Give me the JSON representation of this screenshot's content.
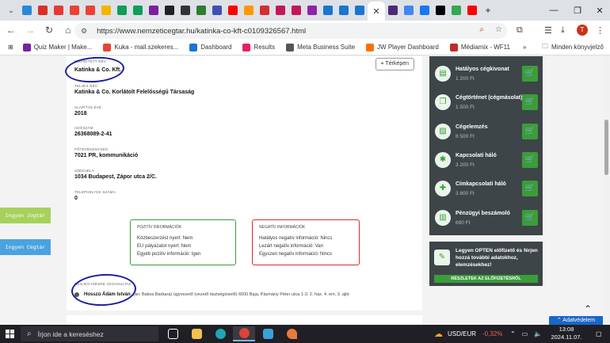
{
  "browser": {
    "url": "https://www.nemzeticegtar.hu/katinka-co-kft-c0109326567.html",
    "tab_favicon_colors": [
      "#2b88d8",
      "#d93025",
      "#e53935",
      "#ea4335",
      "#ea4335",
      "#f4b400",
      "#0f9d58",
      "#0f9d58",
      "#7b1fa2",
      "#212121",
      "#333333",
      "#2e7d32",
      "#3f51b5",
      "#ff0000",
      "#ff9800",
      "#d32f2f",
      "#c2185b",
      "#c2185b",
      "#8e24aa",
      "#1976d2",
      "#1976d2",
      "#1976d2"
    ],
    "right_tab_colors": [
      "#4b2a7a",
      "#4285f4",
      "#1877f2",
      "#000000",
      "#34a853",
      "#ff0000"
    ],
    "new_tab_icon": "plus-icon",
    "window_controls": [
      "minimize-icon",
      "maximize-icon",
      "close-icon"
    ]
  },
  "bookmarks": [
    {
      "label": "Quiz Maker | Make...",
      "color": "#7b1fa2"
    },
    {
      "label": "Kuka - mail.szekeres...",
      "color": "#ea4335"
    },
    {
      "label": "Dashboard",
      "color": "#1976d2"
    },
    {
      "label": "Results",
      "color": "#e91e63"
    },
    {
      "label": "Meta Business Suite",
      "color": "#555555"
    },
    {
      "label": "JW Player Dashboard",
      "color": "#ff6f00"
    },
    {
      "label": "Médiamix - WF11",
      "color": "#c62828"
    }
  ],
  "bookmarks_other": "Minden könyvjelző",
  "company": {
    "short_name_label": "Rövidített név",
    "short_name": "Katinka & Co. Kft.",
    "full_name_label": "Teljes név",
    "full_name": "Katinka & Co. Korlátolt Felelősségű Társaság",
    "founded_label": "Alapítás éve",
    "founded": "2018",
    "tax_label": "Adószám",
    "tax": "26368089-2-41",
    "activity_label": "Főtevékenység",
    "activity": "7021 PR, kommunikáció",
    "seat_label": "Székhely",
    "seat": "1034 Budapest, Zápor utca 2/C.",
    "sites_label": "Telephelyek száma",
    "sites": "0",
    "map_button": "Térképen"
  },
  "positive": {
    "title": "Pozitív információk",
    "lines": [
      "Közbeszerzést nyert: Nem",
      "EU pályázatot nyert: Nem",
      "Egyéb pozitív információ: Igen"
    ]
  },
  "negative": {
    "title": "Negatív információk",
    "lines": [
      "Hatályos negatív információ: Nincs",
      "Lezárt negatív információ: Van",
      "Egyszeri negatív információ: Nincs"
    ]
  },
  "signatory": {
    "label": "Cégjegyzésre jogosultak",
    "name": "Hosszú Ádám István",
    "details": "(an: Bakos Barbara) ügyvezető (vezető tisztségviselő) 6500 Baja, Pázmány Péter utca 1-3. 2. ház. 4. em. 3. ajtó"
  },
  "side_tags": {
    "jogtar": "Ingyen Jogtár",
    "cegtar": "Ingyen Cégtár"
  },
  "services": [
    {
      "name": "Hatályos cégkivonat",
      "price": "1 200 Ft",
      "icon": "document-icon"
    },
    {
      "name": "Cégtörténet (cégmásolat)",
      "price": "1 500 Ft",
      "icon": "copy-icon"
    },
    {
      "name": "Cégelemzés",
      "price": "8 500 Ft",
      "icon": "chart-icon"
    },
    {
      "name": "Kapcsolati háló",
      "price": "3 200 Ft",
      "icon": "network-icon"
    },
    {
      "name": "Címkapcsolati háló",
      "price": "3 800 Ft",
      "icon": "address-network-icon"
    },
    {
      "name": "Pénzügyi beszámoló",
      "price": "690 Ft",
      "icon": "finance-icon"
    }
  ],
  "promo": {
    "text": "Legyen OPTEN előfizető és férjen hozzá további adatokhoz, elemzésekhez!",
    "button": "RÉSZLETEK AZ ELŐFIZETÉSRŐL"
  },
  "privacy_button": "Adatvédelem",
  "taskbar": {
    "search_placeholder": "Írjon ide a kereséshez",
    "currency": "USD/EUR",
    "change": "-0,32%",
    "time": "13:08",
    "date": "2024.11.07."
  },
  "colors": {
    "accent_green": "#3a9d3a",
    "panel_dark": "#3e4548",
    "positive_border": "#3a9d3a",
    "negative_border": "#d32f2f",
    "annotation_blue": "#1b1f9e",
    "jogtar_bg": "#a6d15b",
    "cegtar_bg": "#4aa3df"
  }
}
